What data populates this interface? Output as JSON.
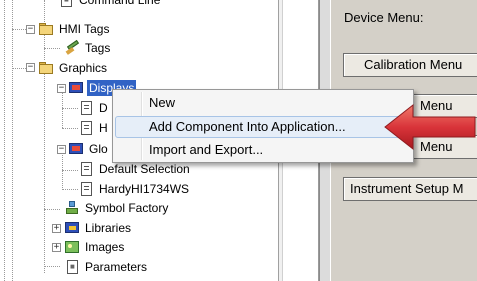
{
  "tree": {
    "items": [
      {
        "label": "Command Line"
      },
      {
        "label": "HMI Tags"
      },
      {
        "label": "Tags"
      },
      {
        "label": "Graphics"
      },
      {
        "label": "Displays"
      },
      {
        "label": "D"
      },
      {
        "label": "H"
      },
      {
        "label": "Glo"
      },
      {
        "label": "Default Selection"
      },
      {
        "label": "HardyHI1734WS"
      },
      {
        "label": "Symbol Factory"
      },
      {
        "label": "Libraries"
      },
      {
        "label": "Images"
      },
      {
        "label": "Parameters"
      }
    ]
  },
  "context_menu": {
    "items": [
      {
        "label": "New"
      },
      {
        "label": "Add Component Into Application..."
      },
      {
        "label": "Import and Export..."
      }
    ]
  },
  "right_panel": {
    "title": "Device Menu:",
    "buttons": [
      {
        "label": "Calibration Menu"
      },
      {
        "label": "Menu"
      },
      {
        "label": "Menu"
      },
      {
        "label": "Instrument Setup M"
      }
    ]
  },
  "colors": {
    "selection": "#3163c5",
    "arrow": "#d9343a",
    "menu_highlight": "#e6eef8"
  }
}
